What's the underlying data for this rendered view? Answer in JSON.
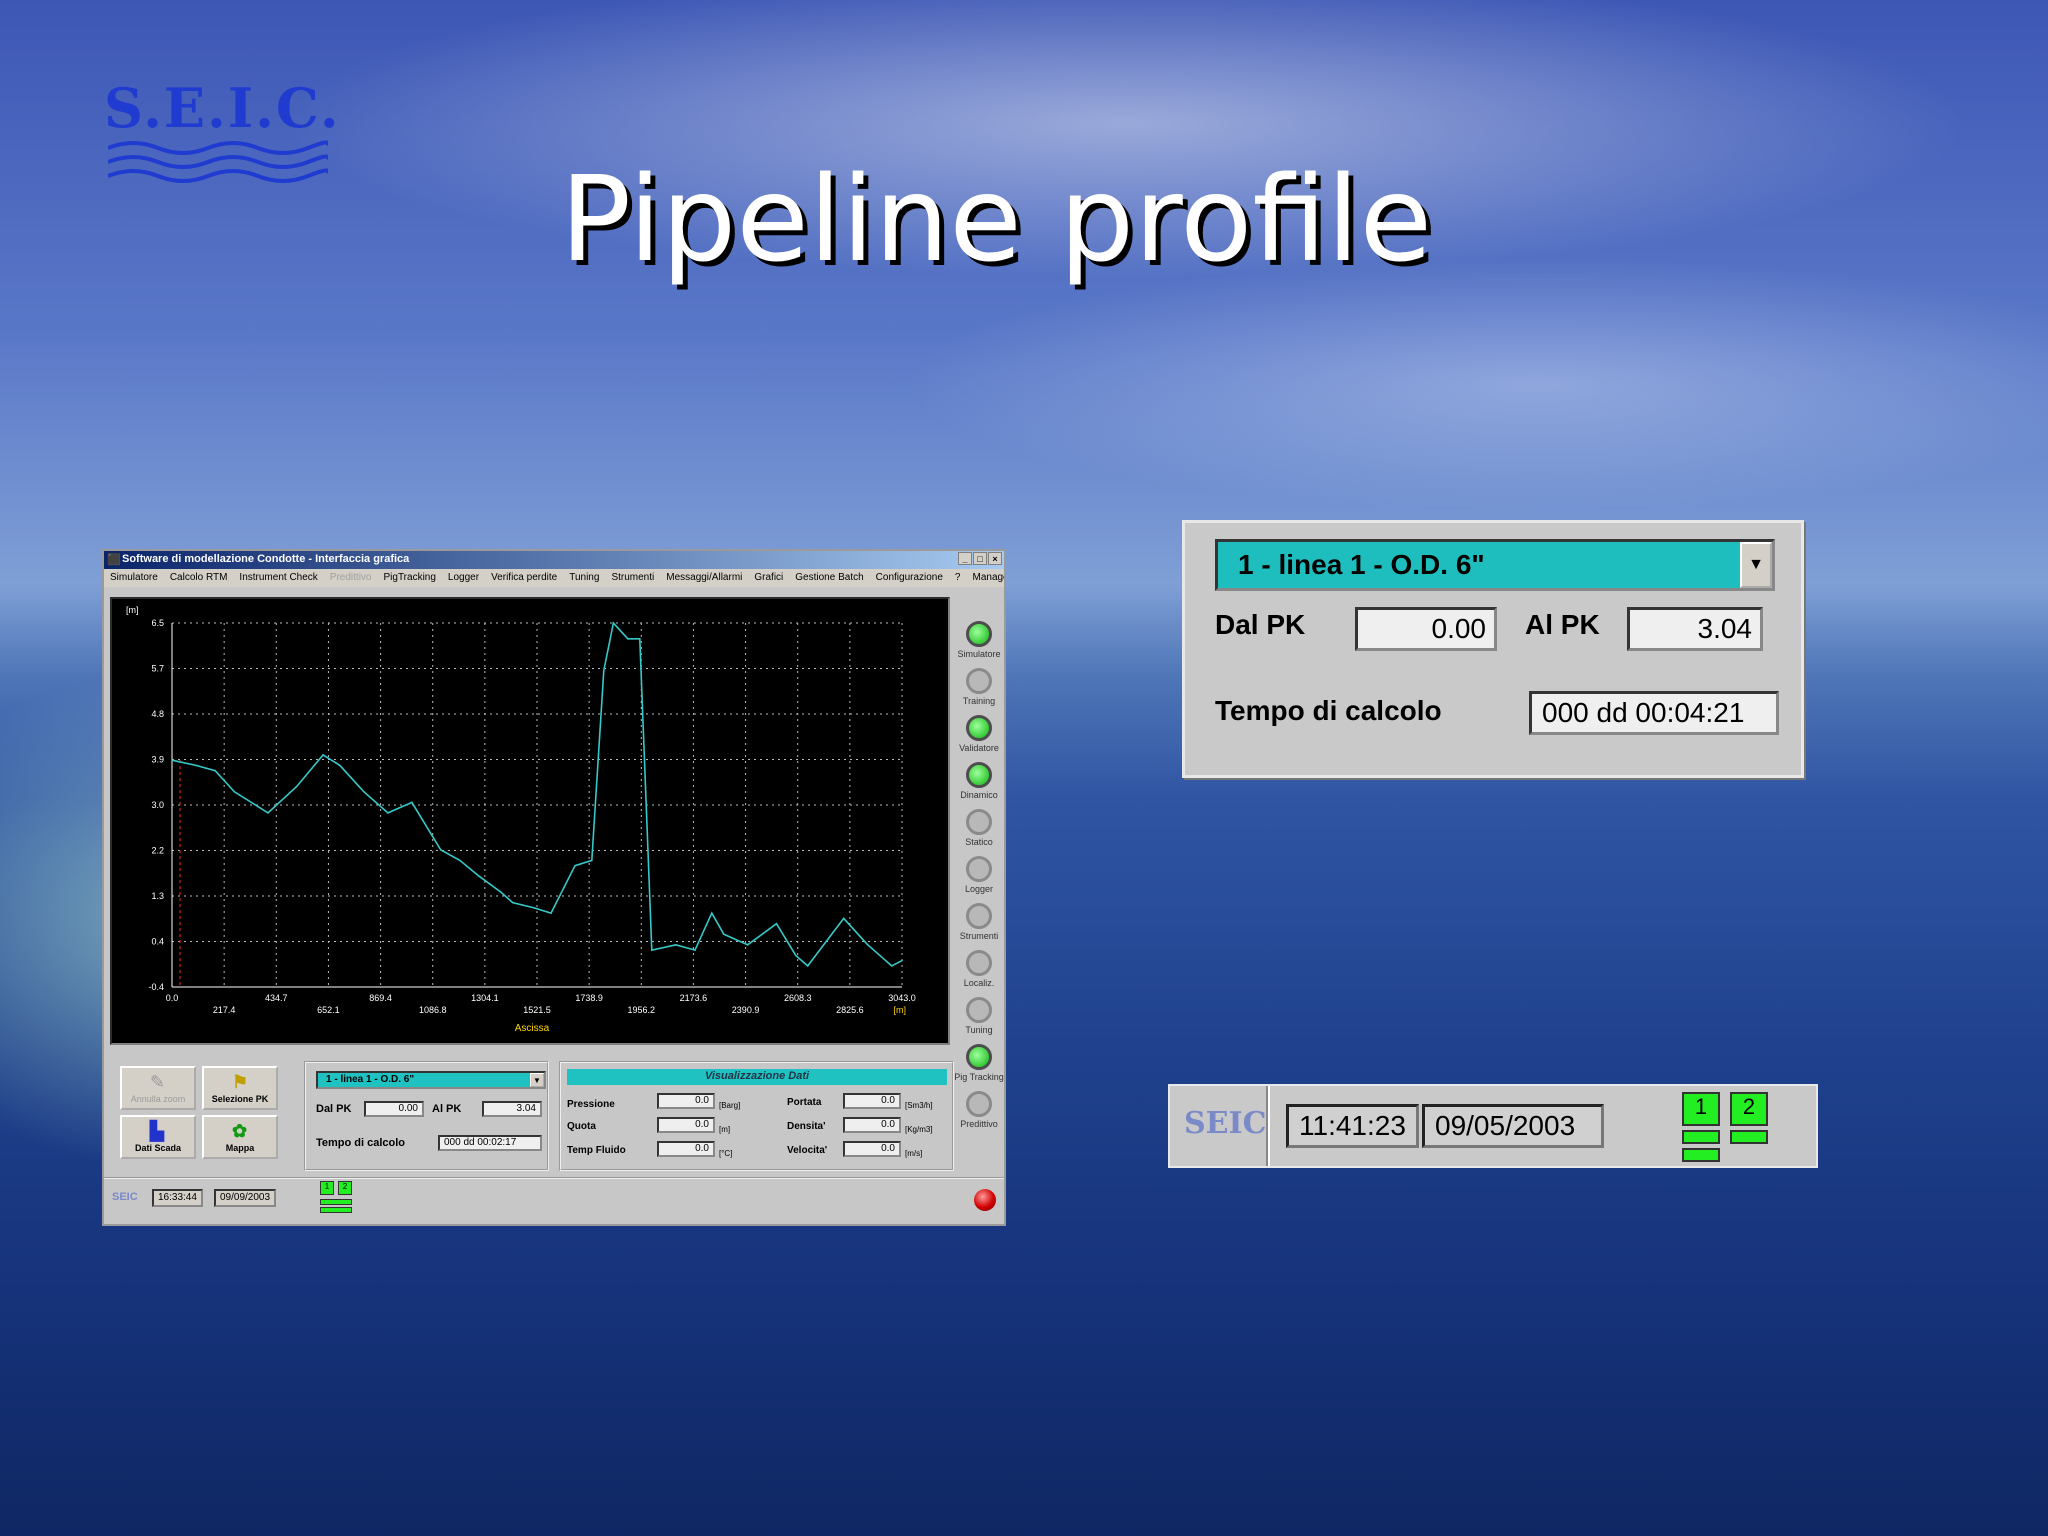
{
  "slide": {
    "title": "Pipeline profile",
    "logo_text": "S.E.I.C."
  },
  "app": {
    "window_title": "Software di modellazione Condotte - Interfaccia grafica",
    "window_buttons": [
      "_",
      "□",
      "×"
    ],
    "menu": [
      "Simulatore",
      "Calcolo RTM",
      "Instrument Check",
      "Predittivo",
      "PigTracking",
      "Logger",
      "Verifica perdite",
      "Tuning",
      "Strumenti",
      "Messaggi/Allarmi",
      "Grafici",
      "Gestione Batch",
      "Configurazione",
      "?"
    ],
    "menu_disabled_index": 3,
    "menu_right": "Manager",
    "leds": [
      {
        "label": "Simulatore",
        "on": true
      },
      {
        "label": "Training",
        "on": false
      },
      {
        "label": "Validatore",
        "on": true
      },
      {
        "label": "Dinamico",
        "on": true
      },
      {
        "label": "Statico",
        "on": false
      },
      {
        "label": "Logger",
        "on": false
      },
      {
        "label": "Strumenti",
        "on": false
      },
      {
        "label": "Localiz.",
        "on": false
      },
      {
        "label": "Tuning",
        "on": false
      },
      {
        "label": "Pig Tracking",
        "on": true
      },
      {
        "label": "Predittivo",
        "on": false
      }
    ],
    "tools": {
      "annulla_zoom": "Annulla zoom",
      "selezione_pk": "Selezione PK",
      "dati_scada": "Dati Scada",
      "mappa": "Mappa"
    },
    "selection": {
      "line": "1 - linea 1 - O.D. 6\"",
      "dal_pk_label": "Dal PK",
      "dal_pk": "0.00",
      "al_pk_label": "Al PK",
      "al_pk": "3.04",
      "tempo_label": "Tempo di calcolo",
      "tempo": "000 dd   00:02:17"
    },
    "data_panel": {
      "header": "Visualizzazione Dati",
      "rows": [
        {
          "label": "Pressione",
          "value": "0.0",
          "unit": "[Barg]"
        },
        {
          "label": "Quota",
          "value": "0.0",
          "unit": "[m]"
        },
        {
          "label": "Temp Fluido",
          "value": "0.0",
          "unit": "[°C]"
        },
        {
          "label": "Portata",
          "value": "0.0",
          "unit": "[Sm3/h]"
        },
        {
          "label": "Densita'",
          "value": "0.0",
          "unit": "[Kg/m3]"
        },
        {
          "label": "Velocita'",
          "value": "0.0",
          "unit": "[m/s]"
        }
      ]
    },
    "status": {
      "logo": "SEIC",
      "time": "16:33:44",
      "date": "09/09/2003",
      "ind1": "1",
      "ind2": "2"
    }
  },
  "zoom_selection": {
    "line": "1 - linea 1 - O.D. 6\"",
    "dal_pk_label": "Dal PK",
    "dal_pk": "0.00",
    "al_pk_label": "Al PK",
    "al_pk": "3.04",
    "tempo_label": "Tempo di calcolo",
    "tempo": "000 dd   00:04:21"
  },
  "zoom_status": {
    "logo": "SEIC",
    "time": "11:41:23",
    "date": "09/05/2003",
    "ind1": "1",
    "ind2": "2"
  },
  "chart_data": {
    "type": "line",
    "ylabel": "[m]",
    "xlabel": "Ascissa",
    "xunit": "[m]",
    "y_ticks": [
      "6.5",
      "5.7",
      "4.8",
      "3.9",
      "3.0",
      "2.2",
      "1.3",
      "0.4",
      "-0.4"
    ],
    "x_ticks_upper": [
      "0.0",
      "434.7",
      "869.4",
      "1304.1",
      "1738.9",
      "2173.6",
      "2608.3",
      "3043.0"
    ],
    "x_ticks_lower": [
      "217.4",
      "652.1",
      "1086.8",
      "1521.5",
      "1956.2",
      "2390.9",
      "2825.6"
    ],
    "ylim": [
      -0.4,
      6.5
    ],
    "xlim": [
      0,
      3043
    ],
    "grid": true,
    "series_color": "#37c8c8",
    "x": [
      0,
      100,
      180,
      260,
      400,
      520,
      630,
      700,
      800,
      900,
      1000,
      1120,
      1200,
      1280,
      1370,
      1420,
      1510,
      1580,
      1680,
      1750,
      1800,
      1840,
      1860,
      1900,
      1950,
      2000,
      2100,
      2180,
      2250,
      2300,
      2400,
      2520,
      2600,
      2650,
      2800,
      2900,
      2950,
      3000,
      3043
    ],
    "y": [
      3.9,
      3.8,
      3.7,
      3.3,
      2.9,
      3.4,
      4.0,
      3.8,
      3.3,
      2.9,
      3.1,
      2.2,
      2.0,
      1.7,
      1.4,
      1.2,
      1.1,
      1.0,
      1.9,
      2.0,
      5.6,
      6.5,
      6.4,
      6.2,
      6.2,
      0.3,
      0.4,
      0.3,
      1.0,
      0.6,
      0.4,
      0.8,
      0.2,
      0.0,
      0.9,
      0.4,
      0.2,
      0.0,
      0.1
    ]
  }
}
